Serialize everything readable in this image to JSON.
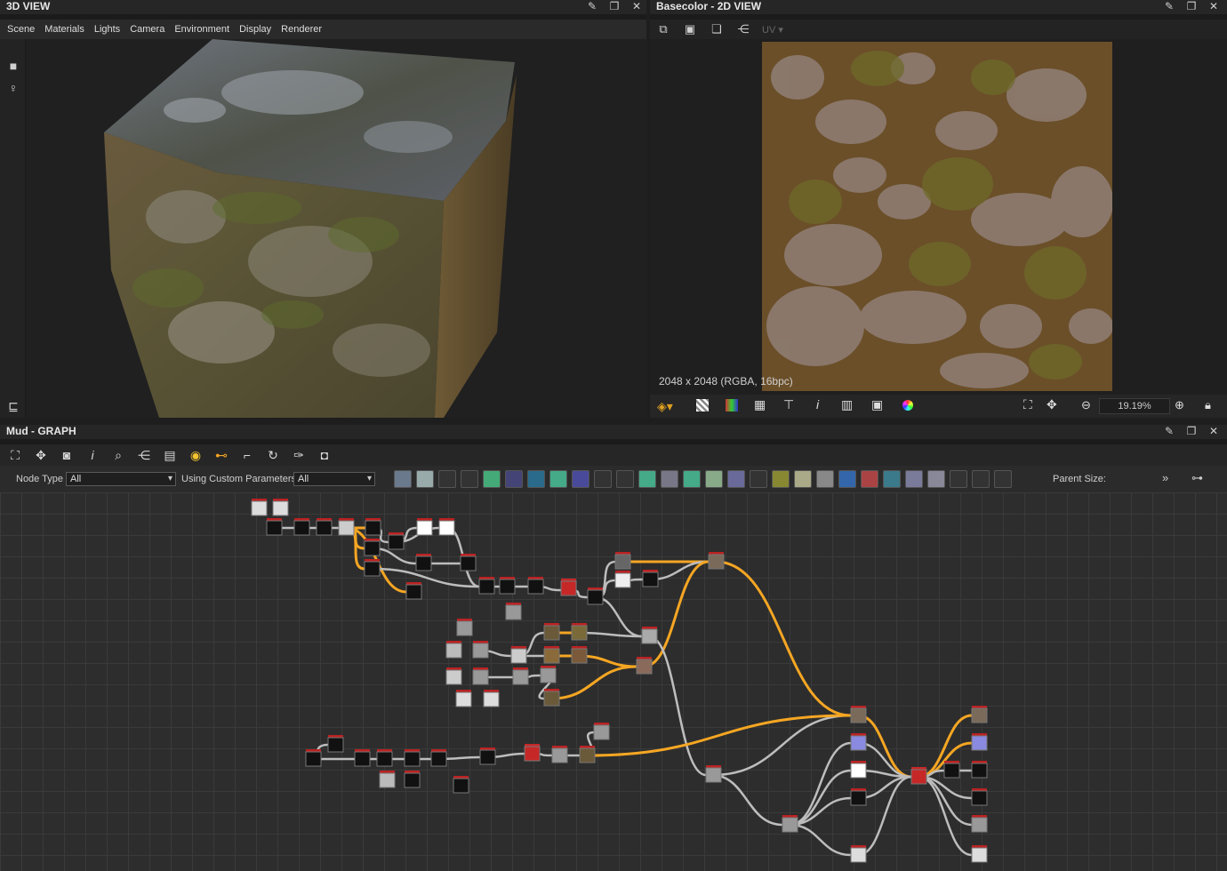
{
  "view3d": {
    "title": "3D VIEW",
    "menu": [
      "Scene",
      "Materials",
      "Lights",
      "Camera",
      "Environment",
      "Display",
      "Renderer"
    ],
    "tool_icons": [
      "camera-icon",
      "bulb-icon",
      "layers-icon"
    ]
  },
  "view2d": {
    "title": "Basecolor - 2D VIEW",
    "uv_label": "UV",
    "resolution": "2048 x 2048 (RGBA, 16bpc)",
    "zoom": "19.19%"
  },
  "graph": {
    "title": "Mud - GRAPH",
    "node_type_label": "Node Type",
    "node_type_value": "All",
    "custom_params_label": "Using Custom Parameters",
    "custom_params_value": "All",
    "parent_size_label": "Parent Size:"
  },
  "colors": {
    "accent_wire": "#f5a623",
    "wire": "#bdbdbd",
    "node_red": "#c62828",
    "bg": "#1e1e1e"
  }
}
